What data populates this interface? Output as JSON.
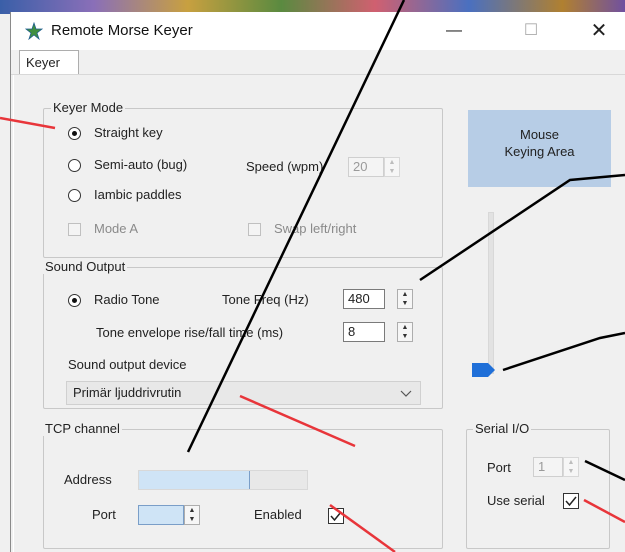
{
  "window": {
    "title": "Remote Morse Keyer",
    "controls": {
      "minimize": "—",
      "maximize": "☐",
      "close": "✕"
    }
  },
  "tabs": [
    {
      "label": "Keyer",
      "selected": true
    }
  ],
  "keyer_mode": {
    "title": "Keyer Mode",
    "options": [
      {
        "label": "Straight key",
        "selected": true
      },
      {
        "label": "Semi-auto (bug)",
        "selected": false
      },
      {
        "label": "Iambic paddles",
        "selected": false
      }
    ],
    "speed_label": "Speed (wpm)",
    "speed_value": "20",
    "mode_a_label": "Mode A",
    "swap_label": "Swap left/right"
  },
  "mouse_area": {
    "line1": "Mouse",
    "line2": "Keying Area"
  },
  "sound_output": {
    "title": "Sound Output",
    "radio_tone_label": "Radio Tone",
    "tone_freq_label": "Tone Freq (Hz)",
    "tone_freq_value": "480",
    "envelope_label": "Tone envelope rise/fall time (ms)",
    "envelope_value": "8",
    "device_label": "Sound output device",
    "device_value": "Primär ljuddrivrutin"
  },
  "tcp": {
    "title": "TCP channel",
    "address_label": "Address",
    "address_value": "",
    "port_label": "Port",
    "port_value": "",
    "enabled_label": "Enabled",
    "enabled_checked": true
  },
  "serial": {
    "title": "Serial I/O",
    "port_label": "Port",
    "port_value": "1",
    "use_serial_label": "Use serial",
    "use_serial_checked": true
  },
  "volume_slider": {
    "level": 0.05
  },
  "colors": {
    "accent": "#1f6fd8",
    "mouse_area": "#b7cde6",
    "annotation_red": "#e8353a",
    "annotation_black": "#000000"
  },
  "icons": {
    "app": "star-icon",
    "dropdown": "chevron-down-icon",
    "spin": "spin-arrows-icon"
  }
}
